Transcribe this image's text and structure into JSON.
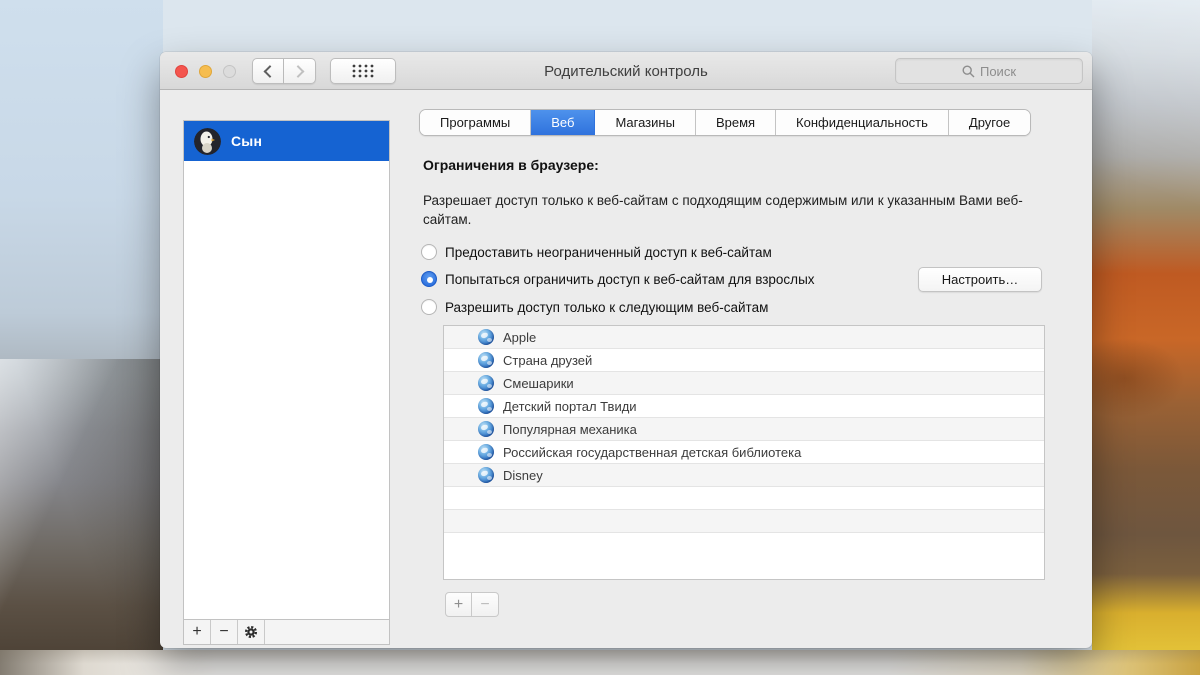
{
  "window": {
    "title": "Родительский контроль"
  },
  "toolbar": {
    "search_placeholder": "Поиск"
  },
  "tabs": [
    {
      "label": "Программы",
      "selected": false
    },
    {
      "label": "Веб",
      "selected": true
    },
    {
      "label": "Магазины",
      "selected": false
    },
    {
      "label": "Время",
      "selected": false
    },
    {
      "label": "Конфиденциальность",
      "selected": false
    },
    {
      "label": "Другое",
      "selected": false
    }
  ],
  "sidebar": {
    "user": "Сын",
    "add_label": "+",
    "remove_label": "−"
  },
  "web": {
    "heading": "Ограничения в браузере:",
    "description": "Разрешает доступ только к веб-сайтам с подходящим содержимым или к указанным Вами веб-сайтам.",
    "options": [
      {
        "label": "Предоставить неограниченный доступ к веб-сайтам",
        "selected": false
      },
      {
        "label": "Попытаться ограничить доступ к веб-сайтам для взрослых",
        "selected": true
      },
      {
        "label": "Разрешить доступ только к следующим веб-сайтам",
        "selected": false
      }
    ],
    "customize_button": "Настроить…",
    "sites": [
      "Apple",
      "Страна друзей",
      "Смешарики",
      "Детский портал Твиди",
      "Популярная механика",
      "Российская государственная детская библиотека",
      "Disney"
    ],
    "add_label": "+",
    "remove_label": "−"
  },
  "colors": {
    "selection_blue": "#1563d2",
    "tab_blue": "#2f72dd",
    "radio_blue": "#1e63d8"
  }
}
